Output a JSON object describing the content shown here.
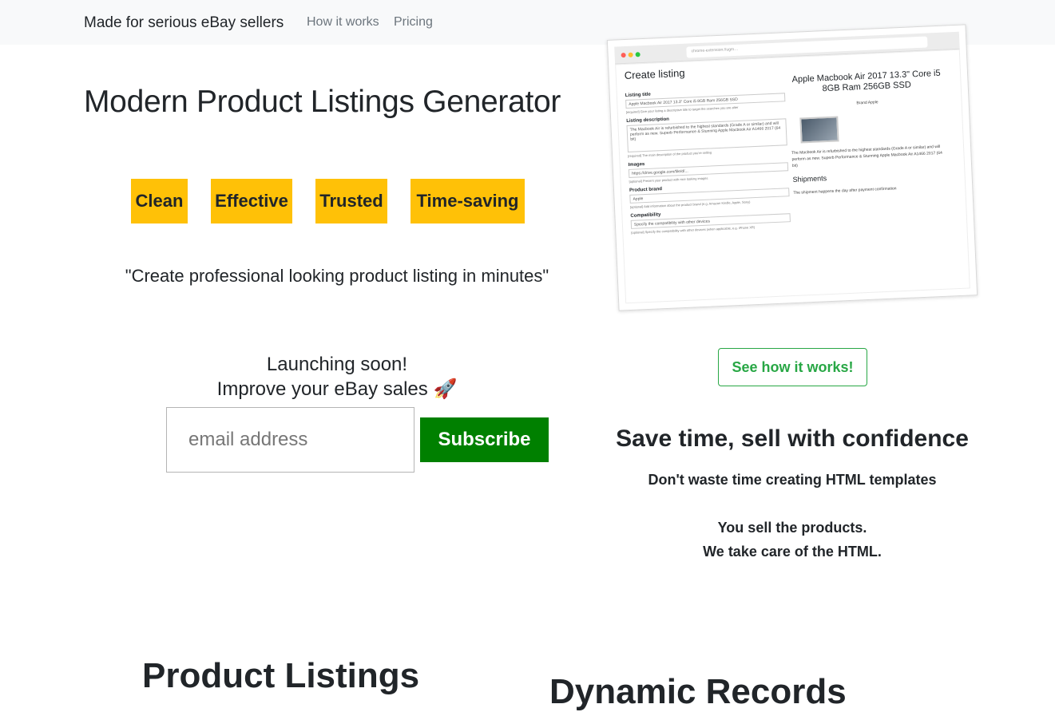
{
  "navbar": {
    "brand": "Made for serious eBay sellers",
    "links": [
      "How it works",
      "Pricing"
    ]
  },
  "hero": {
    "title": "Modern Product Listings Generator",
    "tags": [
      "Clean",
      "Effective",
      "Trusted",
      "Time-saving"
    ],
    "quote": "\"Create professional looking product listing in minutes\"",
    "launch_line1": "Launching soon!",
    "launch_line2": "Improve your eBay sales 🚀",
    "email_placeholder": "email address",
    "subscribe_label": "Subscribe"
  },
  "mockup": {
    "heading": "Create listing",
    "url": "chrome-extension://ugm…",
    "fields": [
      {
        "label": "Listing title",
        "value": "Apple Macbook Air 2017 13.3\" Core i5 8GB Ram 256GB SSD",
        "hint": "[required] Give your listing a descriptive title to target the searches you are after"
      },
      {
        "label": "Listing description",
        "value": "The Macbook Air is refurbished to the highest standards (Grade A or similar) and will perform as new. Superb Performance & Stunning Apple Macbook Air A1466 2017 (64 bit)",
        "hint": "[required] The main description of the product you're selling"
      },
      {
        "label": "Images",
        "value": "https://drive.google.com/file/d/...",
        "hint": "[optional] Present your product with nice looking images"
      },
      {
        "label": "Product brand",
        "value": "Apple",
        "hint": "[optional] Add information about the product brand (e.g. Amazon Kindle, Apple, Sony)"
      },
      {
        "label": "Compatibility",
        "value": "Specify the compatibility with other devices",
        "hint": "[optional] Specify the compatibility with other devices (when applicable, e.g. iPhone XR)"
      }
    ],
    "preview_title": "Apple Macbook Air 2017 13.3\" Core i5 8GB Ram 256GB SSD",
    "preview_brand": "Brand    Apple",
    "preview_text": "The Macbook Air is refurbished to the highest standards (Grade A or similar) and will perform as new. Superb Performance & Stunning Apple Macbook Air A1466 2017 (64 bit)",
    "preview_shipments_title": "Shipments",
    "preview_shipments_text": "The shipment happens the day after payment confirmation"
  },
  "how": {
    "button_label": "See how it works!"
  },
  "save": {
    "title": "Save time, sell with confidence",
    "line1": "Don't waste time creating HTML templates",
    "line2": "You sell the products.",
    "line3": "We take care of the HTML."
  },
  "bottom": {
    "left_heading": "Product Listings",
    "right_heading": "Dynamic Records"
  },
  "colors": {
    "nav_bg": "#f8f9fa",
    "tag_bg": "#ffc107",
    "subscribe_bg": "#008000",
    "outline_green": "#28a745"
  }
}
